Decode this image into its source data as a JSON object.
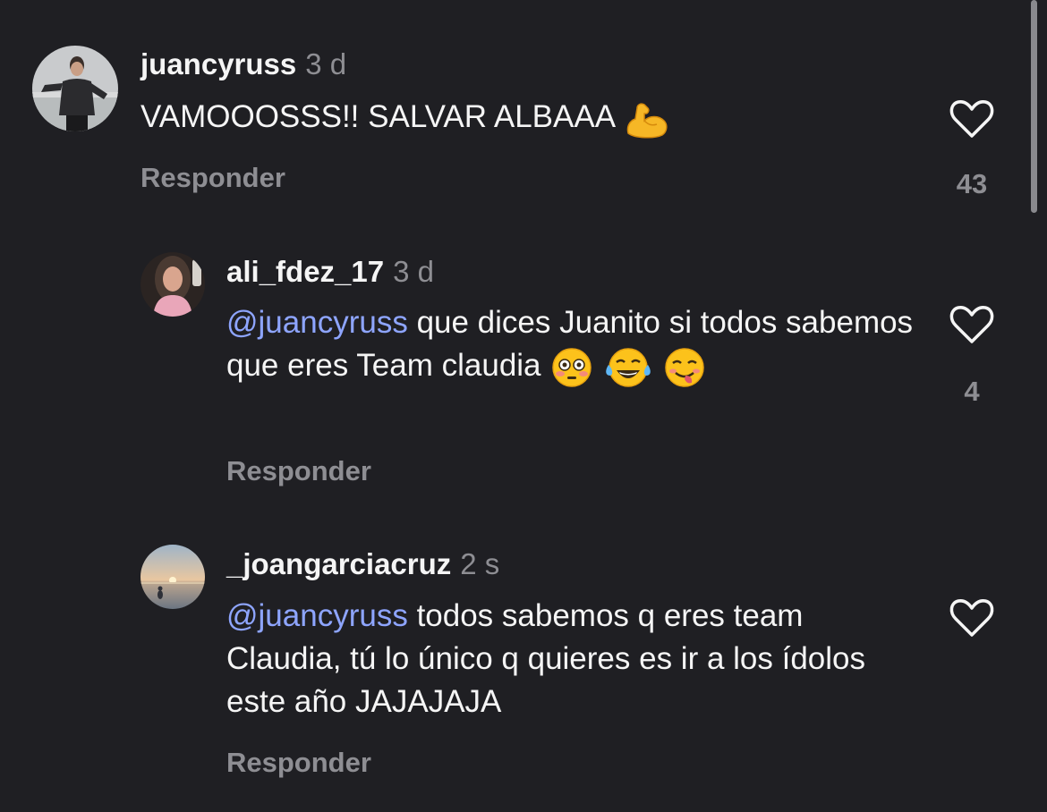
{
  "comments": [
    {
      "username": "juancyruss",
      "time": "3 d",
      "text": "VAMOOOSSS!! SALVAR ALBAAA",
      "emoji": "flexed-biceps-emoji",
      "reply_label": "Responder",
      "likes": "43"
    },
    {
      "username": "ali_fdez_17",
      "time": "3 d",
      "mention": "@juancyruss",
      "text": "que dices Juanito si todos sabemos que eres Team claudia",
      "emojis": [
        "flushed-face-emoji",
        "tears-of-joy-emoji",
        "yum-face-emoji"
      ],
      "reply_label": "Responder",
      "likes": "4"
    },
    {
      "username": "_joangarciacruz",
      "time": "2 s",
      "mention": "@juancyruss",
      "text": "todos sabemos q eres team Claudia, tú lo único q quieres es ir a los ídolos este año JAJAJAJA",
      "reply_label": "Responder",
      "likes": ""
    }
  ],
  "colors": {
    "background": "#1f1f23",
    "mention": "#8ea5ff",
    "secondary_text": "#8e8e93",
    "primary_text": "#f5f5f5"
  },
  "icons": {
    "like": "heart-outline-icon"
  }
}
